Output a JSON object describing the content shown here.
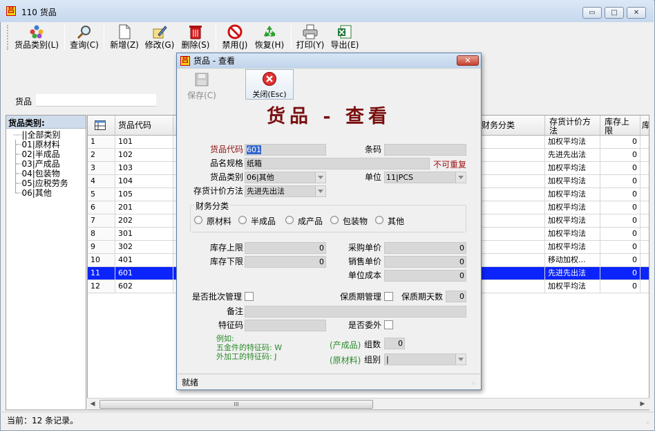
{
  "window": {
    "title": "110 货品",
    "min_label": "▭",
    "max_label": "□",
    "close_label": "✕"
  },
  "toolbar": {
    "buttons": [
      {
        "label": "货品类别(L)",
        "icon": "category-icon"
      },
      {
        "label": "查询(C)",
        "icon": "search-icon"
      },
      {
        "label": "新增(Z)",
        "icon": "new-document-icon"
      },
      {
        "label": "修改(G)",
        "icon": "edit-icon"
      },
      {
        "label": "删除(S)",
        "icon": "trash-icon"
      },
      {
        "label": "禁用(J)",
        "icon": "disable-icon"
      },
      {
        "label": "恢复(H)",
        "icon": "recycle-icon"
      },
      {
        "label": "打印(Y)",
        "icon": "printer-icon"
      },
      {
        "label": "导出(E)",
        "icon": "excel-export-icon"
      }
    ]
  },
  "search": {
    "label": "货品",
    "value": ""
  },
  "tree": {
    "header": "货品类别:",
    "items": [
      "||全部类别",
      "01|原材料",
      "02|半成品",
      "03|产成品",
      "04|包装物",
      "05|应税劳务",
      "06|其他"
    ]
  },
  "grid": {
    "headers": {
      "code": "货品代码",
      "finance": "财务分类",
      "valuation": "存货计价方法",
      "upper": "库存上限",
      "extra": "库"
    },
    "rows": [
      {
        "no": "1",
        "code": "101",
        "valuation": "加权平均法",
        "upper": "0"
      },
      {
        "no": "2",
        "code": "102",
        "valuation": "先进先出法",
        "upper": "0"
      },
      {
        "no": "3",
        "code": "103",
        "valuation": "加权平均法",
        "upper": "0"
      },
      {
        "no": "4",
        "code": "104",
        "valuation": "加权平均法",
        "upper": "0"
      },
      {
        "no": "5",
        "code": "105",
        "valuation": "加权平均法",
        "upper": "0"
      },
      {
        "no": "6",
        "code": "201",
        "valuation": "加权平均法",
        "upper": "0"
      },
      {
        "no": "7",
        "code": "202",
        "valuation": "加权平均法",
        "upper": "0"
      },
      {
        "no": "8",
        "code": "301",
        "valuation": "加权平均法",
        "upper": "0"
      },
      {
        "no": "9",
        "code": "302",
        "valuation": "加权平均法",
        "upper": "0"
      },
      {
        "no": "10",
        "code": "401",
        "valuation": "移动加权...",
        "upper": "0"
      },
      {
        "no": "11",
        "code": "601",
        "valuation": "先进先出法",
        "upper": "0"
      },
      {
        "no": "12",
        "code": "602",
        "valuation": "加权平均法",
        "upper": "0"
      }
    ],
    "selected_row": 11,
    "scroll_grip": "III"
  },
  "status": {
    "text": "当前：12 条记录。"
  },
  "dialog": {
    "title": "货品 - 查看",
    "save_label": "保存(C)",
    "close_label": "关闭(Esc)",
    "heading": "货品 - 查看",
    "fields": {
      "code_label": "货品代码",
      "code_value": "601",
      "barcode_label": "条码",
      "barcode_value": "",
      "spec_label": "品名规格",
      "spec_value": "纸箱",
      "unique_note": "不可重复",
      "category_label": "货品类别",
      "category_value": "06|其他",
      "unit_label": "单位",
      "unit_value": "11|PCS",
      "valuation_label": "存货计价方法",
      "valuation_value": "先进先出法",
      "finance_label": "财务分类",
      "finance_options": [
        "原材料",
        "半成品",
        "成产品",
        "包装物",
        "其他"
      ],
      "upper_label": "库存上限",
      "upper_value": "0",
      "lower_label": "库存下限",
      "lower_value": "0",
      "purchase_label": "采购单价",
      "purchase_value": "0",
      "sale_label": "销售单价",
      "sale_value": "0",
      "cost_label": "单位成本",
      "cost_value": "0",
      "batch_label": "是否批次管理",
      "shelf_label": "保质期管理",
      "shelf_days_label": "保质期天数",
      "shelf_days_value": "0",
      "memo_label": "备注",
      "memo_value": "",
      "feature_label": "特征码",
      "feature_value": "",
      "outsource_label": "是否委外",
      "example_1": "例如:",
      "example_2": "五金件的特征码: W",
      "example_3": "外加工的特征码: J",
      "product_prefix": "(产成品)",
      "group_count_label": "组数",
      "group_count_value": "0",
      "material_prefix": "(原材料)",
      "group_label": "组别",
      "group_value": "|"
    },
    "status": "就绪"
  }
}
